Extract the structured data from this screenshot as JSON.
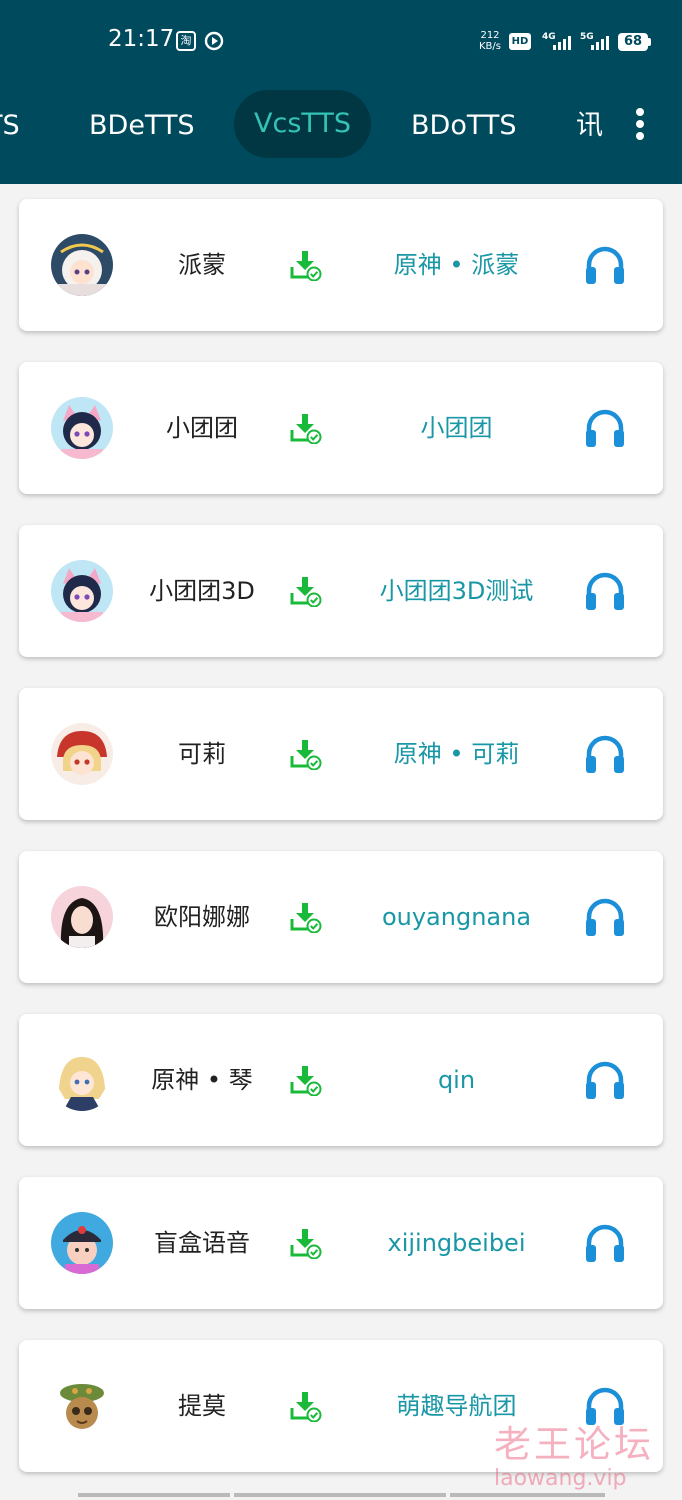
{
  "status_bar": {
    "time": "21:17",
    "app_icon_label": "淘",
    "speed_value": "212",
    "speed_unit": "KB/s",
    "hd_label": "HD",
    "network_4g": "4G",
    "network_5g": "5G",
    "battery": "68"
  },
  "tabs": [
    {
      "label": "TS"
    },
    {
      "label": "BDeTTS"
    },
    {
      "label": "VcsTTS",
      "active": true
    },
    {
      "label": "BDoTTS"
    },
    {
      "label": "讯"
    }
  ],
  "voices": [
    {
      "name": "派蒙",
      "voice": "原神 • 派蒙",
      "avatar": "paimon-avatar"
    },
    {
      "name": "小团团",
      "voice": "小团团",
      "avatar": "xiaotuantuan-avatar"
    },
    {
      "name": "小团团3D",
      "voice": "小团团3D测试",
      "avatar": "xiaotuantuan-3d-avatar"
    },
    {
      "name": "可莉",
      "voice": "原神 • 可莉",
      "avatar": "klee-avatar"
    },
    {
      "name": "欧阳娜娜",
      "voice": "ouyangnana",
      "avatar": "ouyangnana-avatar"
    },
    {
      "name": "原神 • 琴",
      "voice": "qin",
      "avatar": "jean-avatar"
    },
    {
      "name": "盲盒语音",
      "voice": "xijingbeibei",
      "avatar": "blindbox-avatar"
    },
    {
      "name": "提莫",
      "voice": "萌趣导航团",
      "avatar": "teemo-avatar"
    }
  ],
  "icons": {
    "download": "download-check-icon",
    "listen": "headphones-icon",
    "menu": "more-vert-icon"
  },
  "watermark": {
    "title": "老王论坛",
    "url": "laowang.vip"
  },
  "colors": {
    "app_bar": "#004a5e",
    "tab_active_bg": "#003743",
    "tab_active_text": "#35c3b7",
    "voice_text": "#1a97a6",
    "download_green": "#19b93a",
    "headphones_blue": "#1c8fd9"
  }
}
